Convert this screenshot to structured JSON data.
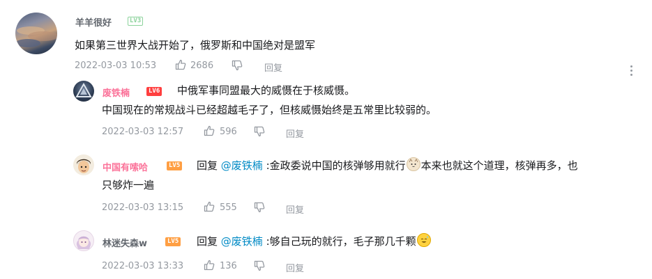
{
  "colors": {
    "username_vip": "#fb7299",
    "username_normal": "#61666d",
    "mention": "#008ac5",
    "meta": "#9499a0"
  },
  "main_comment": {
    "username": "羊羊很好",
    "level": "LV3",
    "content": "如果第三世界大战开始了，俄罗斯和中国绝对是盟军",
    "time": "2022-03-03 10:53",
    "likes": "2686",
    "reply_label": "回复",
    "more_icon": "more-vertical-icon"
  },
  "replies": [
    {
      "username": "废铁楠",
      "level": "LV6",
      "line1": "中俄军事同盟最大的威慑在于核威慑。",
      "line2": "中国现在的常规战斗已经超越毛子了，但核威慑始终是五常里比较弱的。",
      "time": "2022-03-03 12:57",
      "likes": "596",
      "reply_label": "回复"
    },
    {
      "username": "中国有嗦哈",
      "level": "LV5",
      "reply_prefix": "回复",
      "mention": "@废铁楠",
      "text1": ":金政委说中国的核弹够用就行",
      "text2": "本来也就这个道理，核弹再多，也",
      "line2": "只够炸一遍",
      "emoji": "cat-face-emoji",
      "time": "2022-03-03 13:15",
      "likes": "555",
      "reply_label": "回复"
    },
    {
      "username": "林迷失森w",
      "level": "LV5",
      "reply_prefix": "回复",
      "mention": "@废铁楠",
      "text1": ":够自己玩的就行，毛子那几千颗",
      "emoji": "sweat-smile-emoji",
      "time": "2022-03-03 13:33",
      "likes": "136",
      "reply_label": "回复"
    }
  ]
}
